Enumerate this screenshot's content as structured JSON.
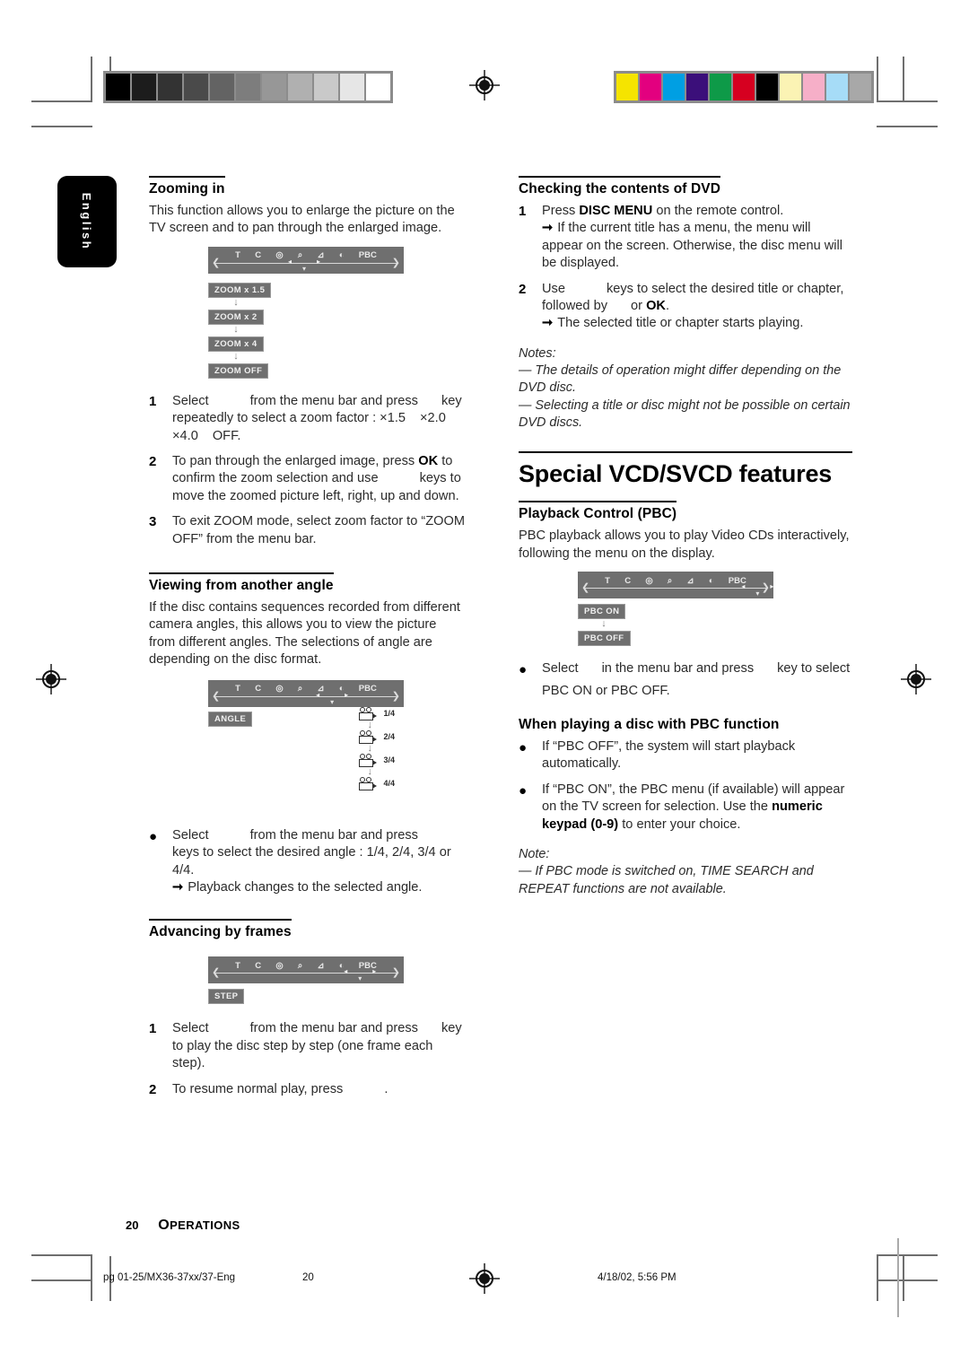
{
  "page": {
    "language_tab": "English",
    "page_number": "20",
    "section_label": "OPERATIONS",
    "footer": {
      "file": "pg 01-25/MX36-37xx/37-Eng",
      "page": "20",
      "timestamp": "4/18/02, 5:56 PM"
    }
  },
  "calibration": {
    "grayscale": [
      "#000000",
      "#1c1c1c",
      "#333333",
      "#4a4a4a",
      "#636363",
      "#7d7d7d",
      "#979797",
      "#b0b0b0",
      "#c9c9c9",
      "#e6e6e6",
      "#ffffff"
    ],
    "colors": [
      "#f5e400",
      "#e3007f",
      "#009fe3",
      "#3b0f7a",
      "#0e9a48",
      "#d60020",
      "#000000",
      "#fbf3b4",
      "#f6afc8",
      "#a6dcf7",
      "#a8a8a8"
    ]
  },
  "osd": {
    "icons": [
      "T",
      "C",
      "repeat-icon",
      "zoom-icon",
      "angle-icon",
      "step-icon",
      "PBC"
    ],
    "icon_labels": [
      "T",
      "C",
      "◎",
      "⌕",
      "⊿",
      "◐",
      "PBC"
    ]
  },
  "left_column": {
    "zooming": {
      "heading": "Zooming in",
      "intro": "This function allows you to enlarge the picture on the TV screen and to pan through the enlarged image.",
      "zoom_boxes": [
        "ZOOM  x 1.5",
        "ZOOM  x 2",
        "ZOOM  x 4",
        "ZOOM  OFF"
      ],
      "steps": [
        {
          "num": "1",
          "text_a": "Select",
          "text_b": "from the menu bar and press",
          "text_c": "key repeatedly to select a zoom factor : ×1.5",
          "text_d": "×2.0",
          "text_e": "×4.0",
          "text_f": "OFF."
        },
        {
          "num": "2",
          "text_a": "To pan through the enlarged image, press",
          "bold": "OK",
          "text_b": "to confirm the zoom selection and use",
          "text_c": "keys to move the zoomed picture left, right, up and down."
        },
        {
          "num": "3",
          "text_a": "To exit ZOOM mode, select zoom factor to “ZOOM OFF” from the menu bar."
        }
      ]
    },
    "angle": {
      "heading": "Viewing from another angle",
      "intro": "If the disc contains sequences recorded from different camera angles, this allows you to view the picture from different angles. The selections of angle are depending on the disc format.",
      "osd_box": "ANGLE",
      "angle_labels": [
        "1/4",
        "2/4",
        "3/4",
        "4/4"
      ],
      "bullet_a": "Select",
      "bullet_b": "from the menu bar and press",
      "bullet_c": "keys to select the desired angle : 1/4, 2/4, 3/4 or 4/4.",
      "arrow_line": "Playback changes to the selected angle."
    },
    "frames": {
      "heading": "Advancing by frames",
      "osd_box": "STEP",
      "steps": [
        {
          "num": "1",
          "text_a": "Select",
          "text_b": "from the menu bar and press",
          "text_c": "key to play the disc step by step (one frame each step)."
        },
        {
          "num": "2",
          "text_a": "To resume normal play, press",
          "text_b": "."
        }
      ]
    }
  },
  "right_column": {
    "dvd_contents": {
      "heading": "Checking the contents of DVD",
      "steps": [
        {
          "num": "1",
          "text_a": "Press",
          "bold": "DISC MENU",
          "text_b": "on the remote control.",
          "arrow": "If the current title has a menu, the menu will appear on the screen. Otherwise, the disc menu will be displayed."
        },
        {
          "num": "2",
          "text_a": "Use",
          "text_b": "keys to select the desired title or chapter, followed by",
          "text_c": "or",
          "bold": "OK",
          "text_d": ".",
          "arrow": "The selected title or chapter starts playing."
        }
      ],
      "notes_heading": "Notes:",
      "notes": [
        "— The details of operation might differ depending on the DVD disc.",
        "— Selecting a title or disc might not be possible on certain DVD discs."
      ]
    },
    "special": {
      "heading": "Special VCD/SVCD features",
      "pbc": {
        "heading": "Playback Control (PBC)",
        "intro": "PBC playback allows you to play Video CDs interactively, following the menu on the display.",
        "boxes": [
          "PBC ON",
          "PBC OFF"
        ],
        "bullet_a": "Select",
        "bullet_b": "in the menu bar and press",
        "bullet_c": "key to select",
        "bullet_d": "PBC ON or PBC OFF."
      },
      "playing": {
        "heading": "When playing a disc with PBC function",
        "bullets": [
          {
            "text_a": "If “PBC OFF”, the system will start playback automatically."
          },
          {
            "text_a": "If “PBC ON”, the PBC menu (if available) will appear on the TV screen for selection. Use the ",
            "bold": "numeric keypad (0-9)",
            "text_b": " to enter your choice."
          }
        ],
        "notes_heading": "Note:",
        "notes": [
          "— If PBC mode is switched on, TIME SEARCH and REPEAT functions are not available."
        ]
      }
    }
  }
}
